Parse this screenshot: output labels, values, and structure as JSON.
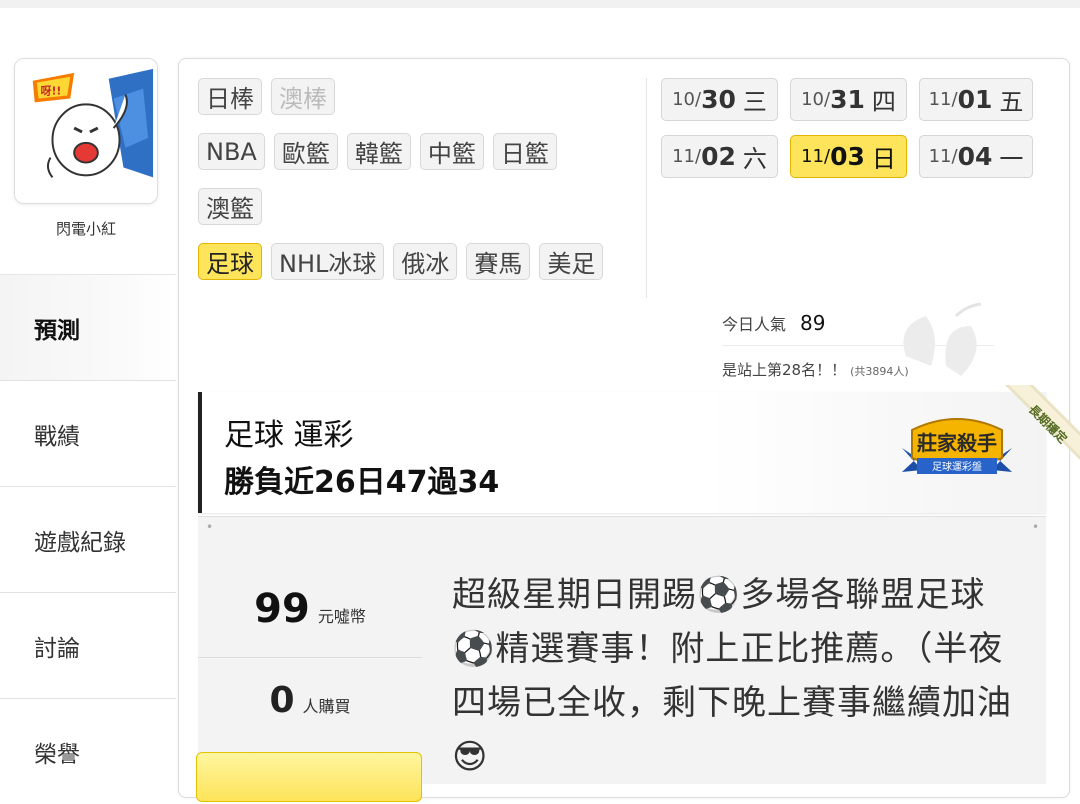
{
  "user": {
    "name": "閃電小紅"
  },
  "side_nav": [
    {
      "label": "預測",
      "active": true
    },
    {
      "label": "戰績",
      "active": false
    },
    {
      "label": "遊戲紀錄",
      "active": false
    },
    {
      "label": "討論",
      "active": false
    },
    {
      "label": "榮譽",
      "active": false
    }
  ],
  "sport_tags": {
    "row1": [
      "日棒",
      "澳棒"
    ],
    "row2": [
      "NBA",
      "歐籃",
      "韓籃",
      "中籃",
      "日籃"
    ],
    "row3": [
      "澳籃"
    ],
    "row4": [
      "足球",
      "NHL冰球",
      "俄冰",
      "賽馬",
      "美足"
    ],
    "selected": "足球",
    "disabled": [
      "澳棒"
    ]
  },
  "dates": [
    {
      "md": "10/",
      "dd": "30",
      "wd": "三"
    },
    {
      "md": "10/",
      "dd": "31",
      "wd": "四"
    },
    {
      "md": "11/",
      "dd": "01",
      "wd": "五"
    },
    {
      "md": "11/",
      "dd": "02",
      "wd": "六"
    },
    {
      "md": "11/",
      "dd": "03",
      "wd": "日"
    },
    {
      "md": "11/",
      "dd": "04",
      "wd": "一"
    }
  ],
  "selected_date": "11/03",
  "popularity": {
    "label": "今日人氣",
    "value": "89"
  },
  "rank": {
    "text": "是站上第28名！！",
    "total": "(共3894人)"
  },
  "header": {
    "title": "足球 運彩",
    "record": "勝負近26日47過34"
  },
  "badge": {
    "title": "莊家殺手",
    "subtitle": "足球運彩盤",
    "ribbon": "長期穩定"
  },
  "price": {
    "value": "99",
    "unit": "元噓幣"
  },
  "buyers": {
    "value": "0",
    "unit": "人購買"
  },
  "description": "超級星期日開踢⚽多場各聯盟足球⚽精選賽事！附上正比推薦。（半夜四場已全收，剩下晚上賽事繼續加油😎",
  "colors": {
    "accent_yellow": "#fde45a",
    "accent_border": "#e3b400"
  }
}
